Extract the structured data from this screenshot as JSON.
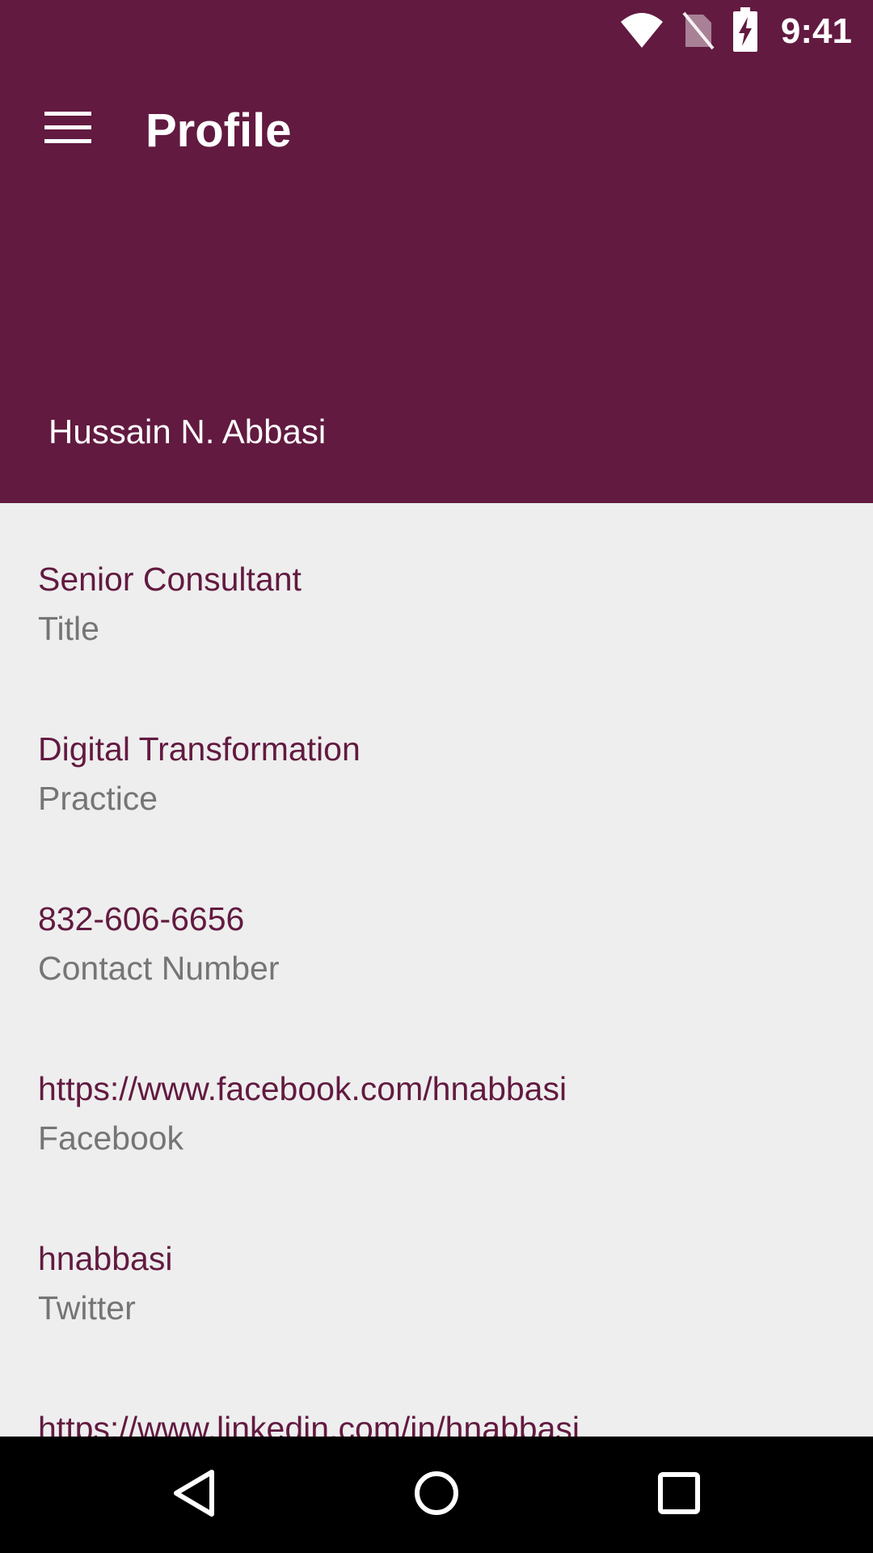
{
  "status_bar": {
    "time": "9:41",
    "icons": [
      "wifi-icon",
      "no-sim-icon",
      "battery-charging-icon"
    ]
  },
  "toolbar": {
    "menu_icon": "hamburger-menu-icon",
    "title": "Profile"
  },
  "profile": {
    "name": "Hussain N. Abbasi"
  },
  "fields": [
    {
      "value": "Senior Consultant",
      "label": "Title"
    },
    {
      "value": "Digital Transformation",
      "label": "Practice"
    },
    {
      "value": "832-606-6656",
      "label": "Contact Number"
    },
    {
      "value": "https://www.facebook.com/hnabbasi",
      "label": "Facebook"
    },
    {
      "value": "hnabbasi",
      "label": "Twitter"
    },
    {
      "value": "https://www.linkedin.com/in/hnabbasi",
      "label": ""
    }
  ],
  "nav_bar": {
    "buttons": [
      "back-icon",
      "home-icon",
      "recents-icon"
    ]
  },
  "colors": {
    "primary": "#621a40",
    "background": "#eeeeee",
    "label_gray": "#757575"
  }
}
